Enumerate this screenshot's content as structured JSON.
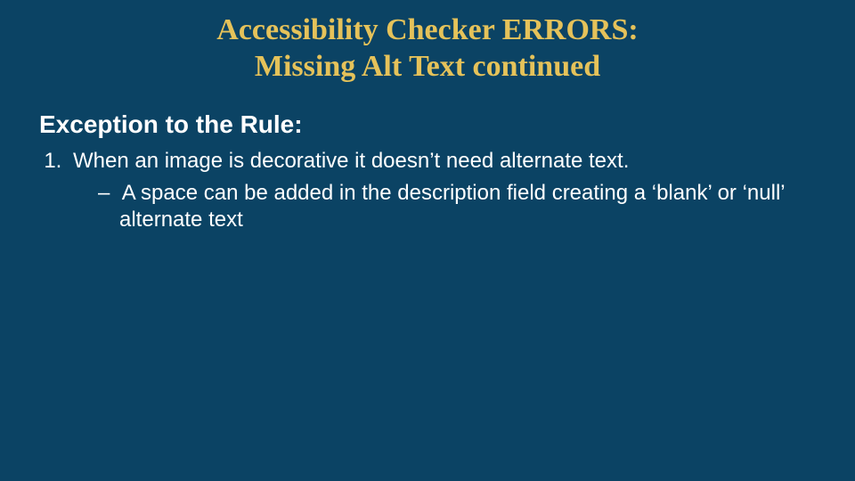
{
  "slide": {
    "title_line1": "Accessibility Checker ERRORS:",
    "title_line2": "Missing Alt Text continued",
    "subtitle": "Exception to the Rule:",
    "list": {
      "item1": "When an image is decorative it doesn’t need alternate text.",
      "sub1": "A space can be added in the description field creating a ‘blank’ or ‘null’ alternate text"
    }
  },
  "colors": {
    "background": "#0b4364",
    "accent": "#e5c25a",
    "text": "#ffffff"
  }
}
